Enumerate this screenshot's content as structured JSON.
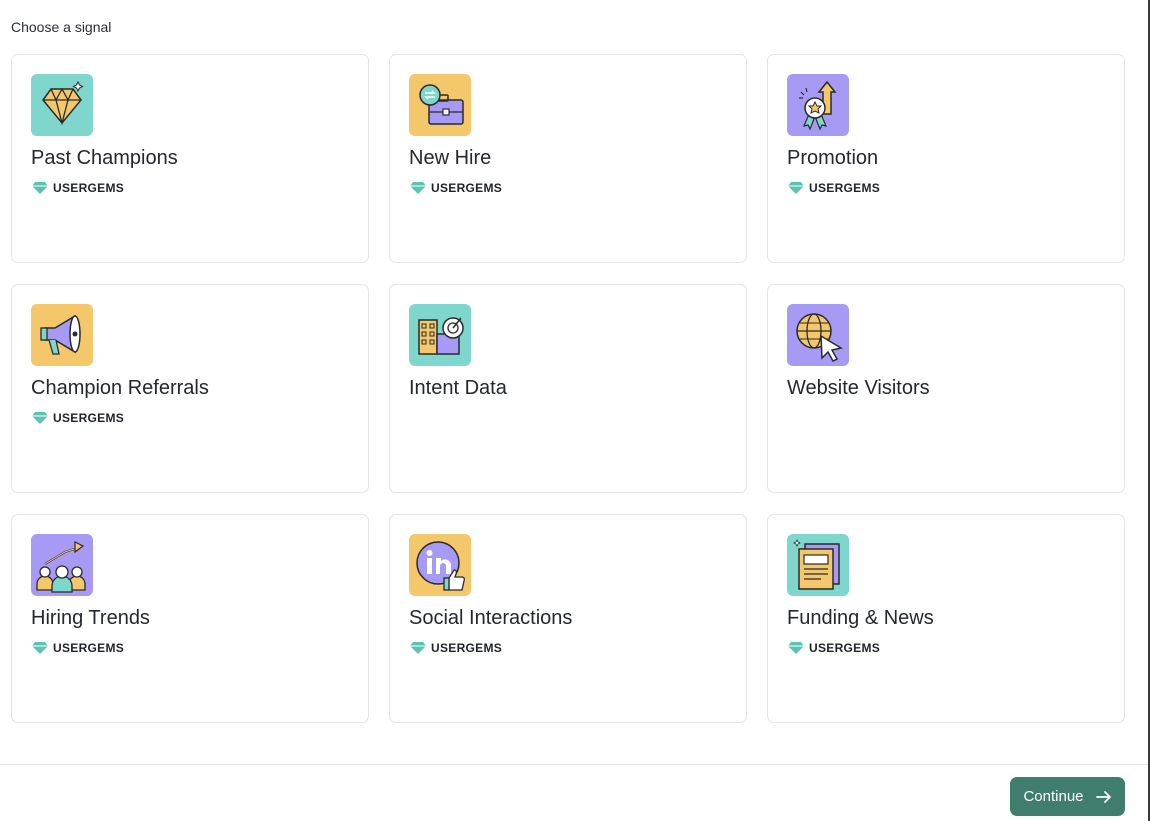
{
  "heading": "Choose a signal",
  "colors": {
    "teal_tile": "#7fd6cc",
    "yellow_tile": "#f4c86a",
    "purple_tile": "#a79af5",
    "button": "#3f7d6f",
    "brand_gem": "#5bc4b0"
  },
  "cards": [
    {
      "title": "Past Champions",
      "brand": "USERGEMS",
      "icon": "diamond-icon",
      "tile": "teal"
    },
    {
      "title": "New Hire",
      "brand": "USERGEMS",
      "icon": "briefcase-icon",
      "tile": "yellow"
    },
    {
      "title": "Promotion",
      "brand": "USERGEMS",
      "icon": "award-arrow-icon",
      "tile": "purple"
    },
    {
      "title": "Champion Referrals",
      "brand": "USERGEMS",
      "icon": "megaphone-icon",
      "tile": "yellow"
    },
    {
      "title": "Intent Data",
      "icon": "building-target-icon",
      "tile": "teal"
    },
    {
      "title": "Website Visitors",
      "icon": "globe-cursor-icon",
      "tile": "purple"
    },
    {
      "title": "Hiring Trends",
      "brand": "USERGEMS",
      "icon": "people-growth-icon",
      "tile": "purple"
    },
    {
      "title": "Social Interactions",
      "brand": "USERGEMS",
      "icon": "linkedin-like-icon",
      "tile": "yellow"
    },
    {
      "title": "Funding & News",
      "brand": "USERGEMS",
      "icon": "newspaper-icon",
      "tile": "teal"
    }
  ],
  "continue_label": "Continue"
}
